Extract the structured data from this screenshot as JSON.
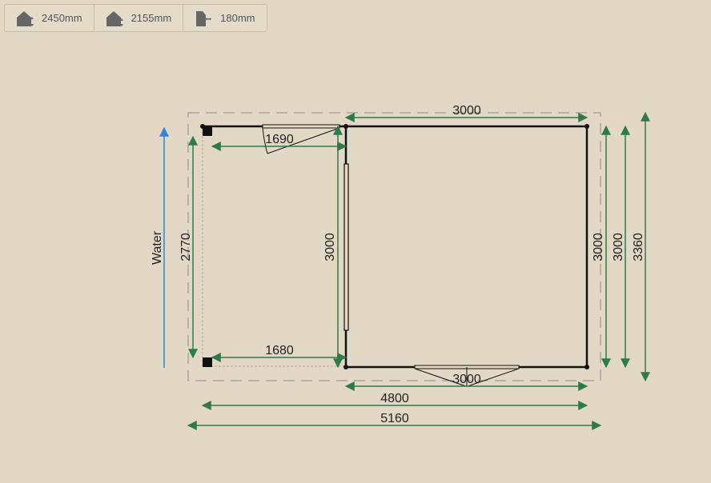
{
  "toolbar": {
    "wall_height": "2450mm",
    "ridge_height": "2155mm",
    "overhang": "180mm"
  },
  "plan": {
    "water_label": "Water",
    "dims": {
      "top_width": "3000",
      "porch_top": "1690",
      "porch_bottom": "1680",
      "porch_depth": "2770",
      "front_wall": "3000",
      "right_inner": "3000",
      "right_mid": "3000",
      "right_outer": "3360",
      "door_width": "3000",
      "total_inner": "4800",
      "total_outer": "5160"
    }
  },
  "colors": {
    "background": "#e2d8c5",
    "dimension": "#2e7a48",
    "water": "#2f86d6",
    "wall": "#111111",
    "outline_dashed": "#999999"
  }
}
